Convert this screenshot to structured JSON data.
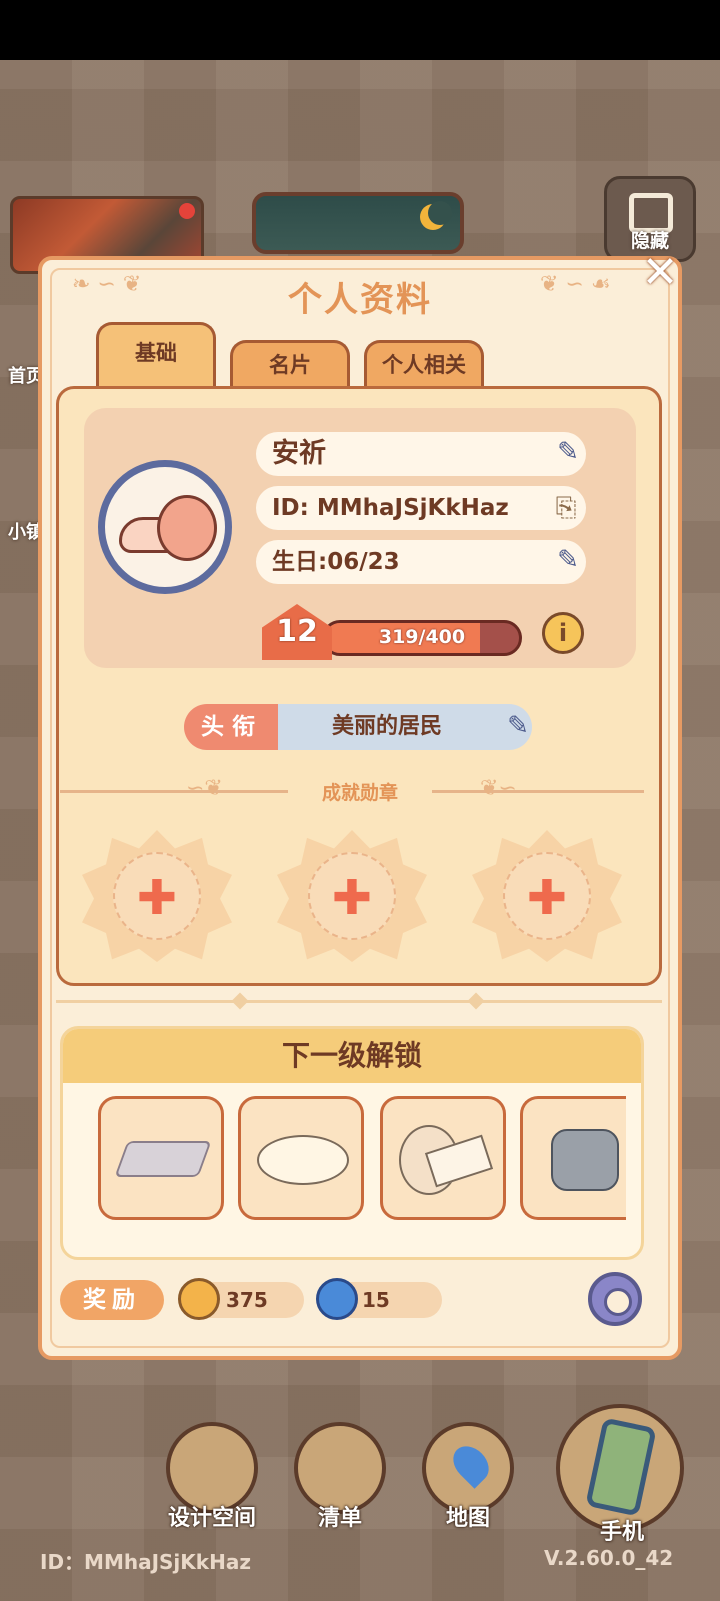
{
  "hud": {
    "hide_label": "隐藏",
    "side_label_1": "首页",
    "side_label_2": "小镇"
  },
  "modal": {
    "title": "个人资料",
    "tabs": [
      "基础",
      "名片",
      "个人相关"
    ],
    "active_tab": "基础",
    "profile": {
      "name": "安祈",
      "id": "ID: MMhaJSjKkHaz",
      "birthday": "生日:06/23",
      "level": "12",
      "xp_text": "319/400",
      "xp_fraction": 0.7975
    },
    "title_label": "头衔",
    "title_value": "美丽的居民",
    "medals_title": "成就勋章",
    "medal_slots": 3,
    "unlock_title": "下一级解锁",
    "reward_label": "奖励",
    "reward_coins": "375",
    "reward_gems": "15"
  },
  "nav": {
    "design_space": "设计空间",
    "list": "清单",
    "map": "地图",
    "phone": "手机"
  },
  "footer": {
    "id": "ID：MMhaJSjKkHaz",
    "version": "V.2.60.0_42"
  },
  "colors": {
    "modal_bg": "#fbeed8",
    "accent": "#e39457",
    "xp_fill": "#f07a52",
    "title_tag": "#ef8a70"
  }
}
